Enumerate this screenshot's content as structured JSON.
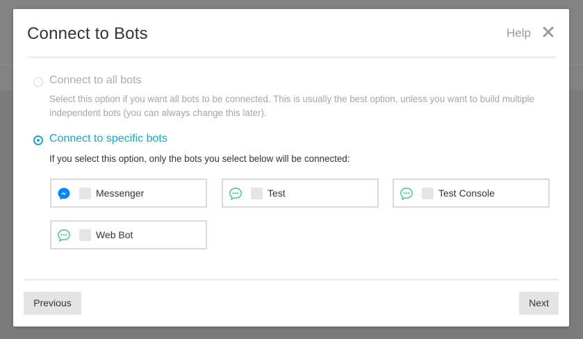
{
  "modal": {
    "title": "Connect to Bots",
    "help_label": "Help",
    "close_icon": "close-icon"
  },
  "options": [
    {
      "label": "Connect to all bots",
      "description": "Select this option if you want all bots to be connected. This is usually the best option, unless you want to build multiple independent bots (you can always change this later).",
      "selected": false
    },
    {
      "label": "Connect to specific bots",
      "description": "If you select this option, only the bots you select below will be connected:",
      "selected": true
    }
  ],
  "bots": [
    {
      "name": "Messenger",
      "icon": "messenger-icon",
      "checked": false
    },
    {
      "name": "Test",
      "icon": "chat-bubble-icon",
      "checked": false
    },
    {
      "name": "Test Console",
      "icon": "chat-bubble-icon",
      "checked": false
    },
    {
      "name": "Web Bot",
      "icon": "chat-bubble-icon",
      "checked": false
    }
  ],
  "footer": {
    "previous_label": "Previous",
    "next_label": "Next"
  },
  "colors": {
    "accent": "#17a8c6",
    "messenger": "#0084ff",
    "chat_icon": "#3cc48a"
  }
}
